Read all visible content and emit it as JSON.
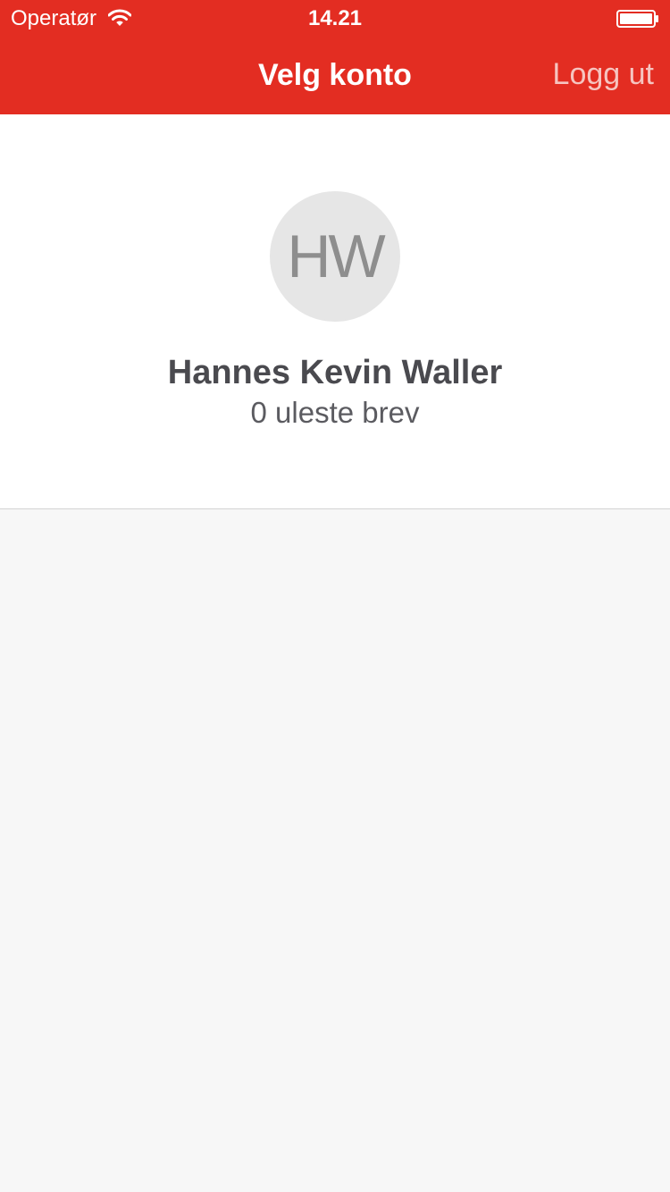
{
  "status_bar": {
    "carrier": "Operatør",
    "time": "14.21",
    "wifi_icon": "wifi-icon",
    "battery_icon": "battery-icon"
  },
  "nav": {
    "title": "Velg konto",
    "logout_label": "Logg ut"
  },
  "account": {
    "initials": "HW",
    "name": "Hannes Kevin Waller",
    "unread": "0 uleste brev"
  },
  "colors": {
    "brand_red": "#e32d22",
    "avatar_bg": "#e6e6e6",
    "page_bg": "#f7f7f7"
  }
}
